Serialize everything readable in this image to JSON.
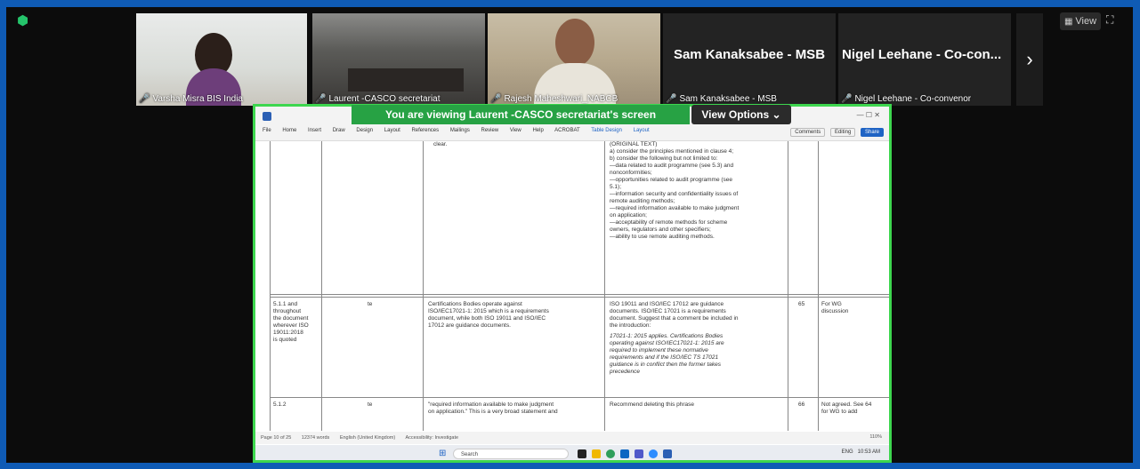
{
  "meeting": {
    "view_label": "View",
    "participants": [
      {
        "label": "Varsha Misra BIS India"
      },
      {
        "label": "Laurent -CASCO secretariat"
      },
      {
        "label": "Rajesh Maheshwari_NABCB"
      },
      {
        "name": "Sam Kanaksabee - MSB",
        "label": "Sam Kanaksabee - MSB"
      },
      {
        "name": "Nigel Leehane - Co-con...",
        "label": "Nigel Leehane - Co-convenor"
      }
    ],
    "next_arrow": "›",
    "banner": "You are viewing  Laurent -CASCO secretariat's screen",
    "view_options": "View Options"
  },
  "word": {
    "tabs": [
      "File",
      "Home",
      "Insert",
      "Draw",
      "Design",
      "Layout",
      "References",
      "Mailings",
      "Review",
      "View",
      "Help",
      "ACROBAT",
      "Table Design",
      "Layout"
    ],
    "right_buttons": {
      "comments": "Comments",
      "editing": "Editing",
      "share": "Share"
    },
    "row0": {
      "col2": "clear.",
      "col4": [
        "(ORIGINAL TEXT)",
        "a) consider the principles mentioned in clause 4;",
        "b) consider the following but not limited to:",
        "—data related to audit programme (see 5.3) and",
        "nonconformities;",
        "—opportunities related to audit programme (see",
        "5.1);",
        "—information security and confidentiality issues of",
        "remote auditing methods;",
        "—required information available to make judgment",
        "on application;",
        "—acceptability of remote methods for scheme",
        "owners, regulators and other specifiers;",
        "—ability to use remote auditing methods."
      ]
    },
    "row1": {
      "col0": [
        "5.1.1 and",
        "throughout",
        "the document",
        "wherever ISO",
        "19011:2018",
        "is quoted"
      ],
      "col1": "te",
      "col2": [
        "Certifications Bodies operate against",
        "ISO/IEC17021-1: 2015 which is a requirements",
        "document, while both ISO 19011 and ISO/IEC",
        "17012 are guidance documents."
      ],
      "col3": [
        "ISO 19011 and ISO/IEC 17012 are guidance",
        "documents. ISO/IEC 17021 is a requirements",
        "document. Suggest that a comment be included in",
        "the introduction:",
        "",
        "17021-1: 2015 applies. Certifications Bodies",
        "operating against ISO/IEC17021-1: 2015 are",
        "required to implement these normative",
        "requirements and if the ISO/IEC TS 17021",
        "guidance is in conflict then the former takes",
        "precedence"
      ],
      "col4": "65",
      "col5": [
        "For WG",
        "discussion"
      ]
    },
    "row2": {
      "col0": "5.1.2",
      "col1": "te",
      "col2": [
        "\"required information available to make judgment",
        "on application.\" This is a very broad statement and"
      ],
      "col3": "Recommend deleting this phrase",
      "col4": "66",
      "col5": [
        "Not agreed. See 64",
        "for WG to add"
      ]
    },
    "status": [
      "Page 10 of 25",
      "12374 words",
      "English (United Kingdom)",
      "Accessibility: Investigate"
    ],
    "zoom": "110%",
    "taskbar_search": "Search",
    "tray": [
      "ENG",
      "10:53 AM"
    ]
  }
}
